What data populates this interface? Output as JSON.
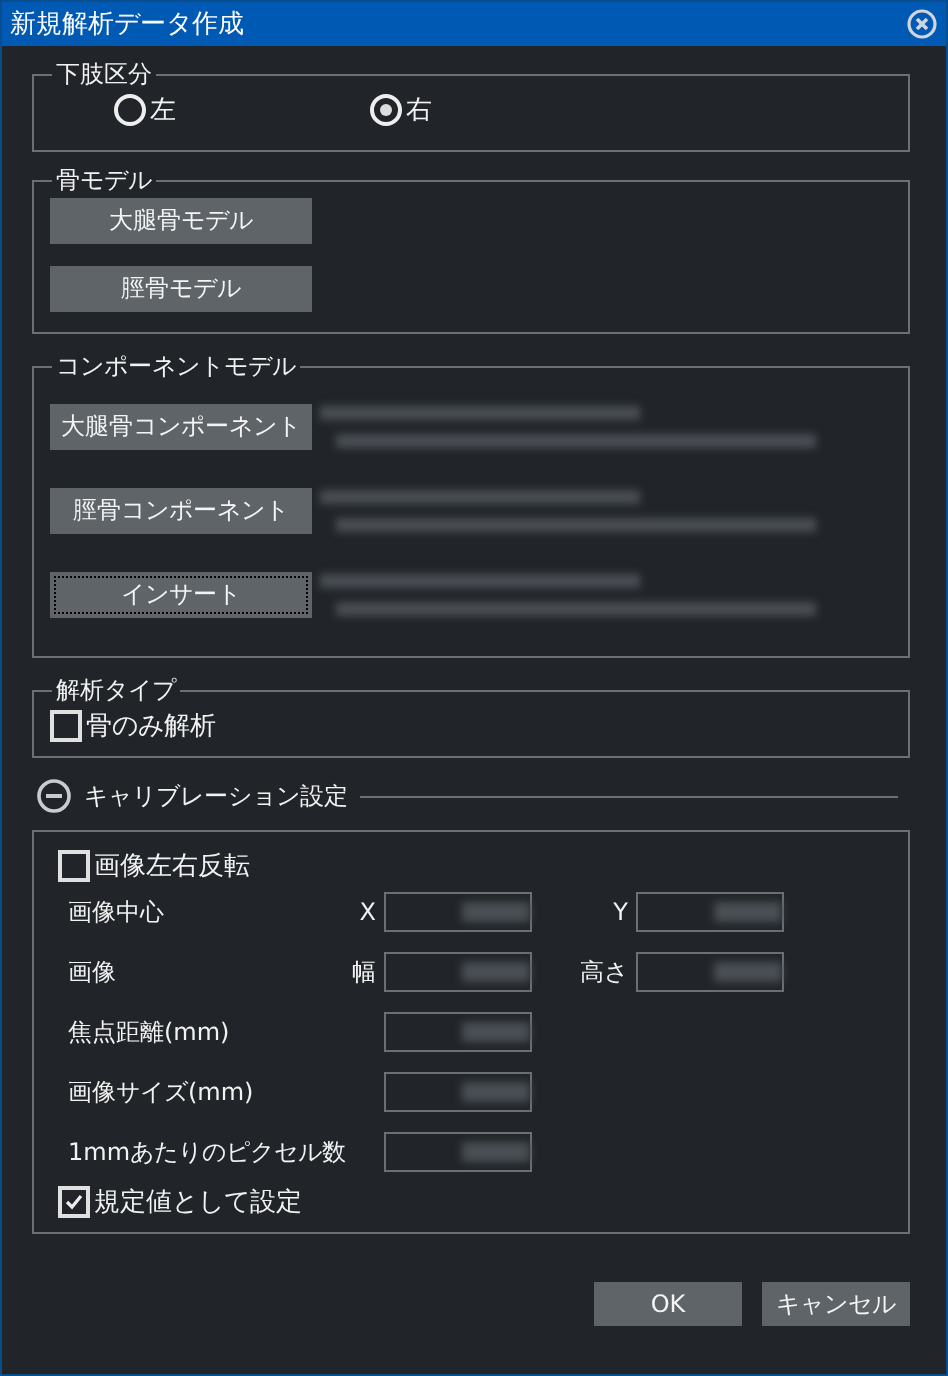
{
  "window": {
    "title": "新規解析データ作成"
  },
  "limb_side": {
    "legend": "下肢区分",
    "options": [
      {
        "label": "左",
        "selected": false
      },
      {
        "label": "右",
        "selected": true
      }
    ]
  },
  "bone_model": {
    "legend": "骨モデル",
    "buttons": [
      "大腿骨モデル",
      "脛骨モデル"
    ]
  },
  "component_model": {
    "legend": "コンポーネントモデル",
    "items": [
      {
        "button": "大腿骨コンポーネント",
        "focused": false
      },
      {
        "button": "脛骨コンポーネント",
        "focused": false
      },
      {
        "button": "インサート",
        "focused": true
      }
    ]
  },
  "analysis_type": {
    "legend": "解析タイプ",
    "option": {
      "label": "骨のみ解析",
      "checked": false
    }
  },
  "calibration": {
    "title": "キャリブレーション設定",
    "expanded": true,
    "flip": {
      "label": "画像左右反転",
      "checked": false
    },
    "rows": [
      {
        "kind": "pair",
        "label": "画像中心",
        "fields": [
          "X",
          "Y"
        ]
      },
      {
        "kind": "pair",
        "label": "画像",
        "fields": [
          "幅",
          "高さ"
        ]
      },
      {
        "kind": "single",
        "label": "焦点距離(mm)"
      },
      {
        "kind": "single",
        "label": "画像サイズ(mm)"
      },
      {
        "kind": "single",
        "label": "1mmあたりのピクセル数"
      }
    ],
    "default": {
      "label": "規定値として設定",
      "checked": true
    }
  },
  "buttons": [
    "OK",
    "キャンセル"
  ]
}
